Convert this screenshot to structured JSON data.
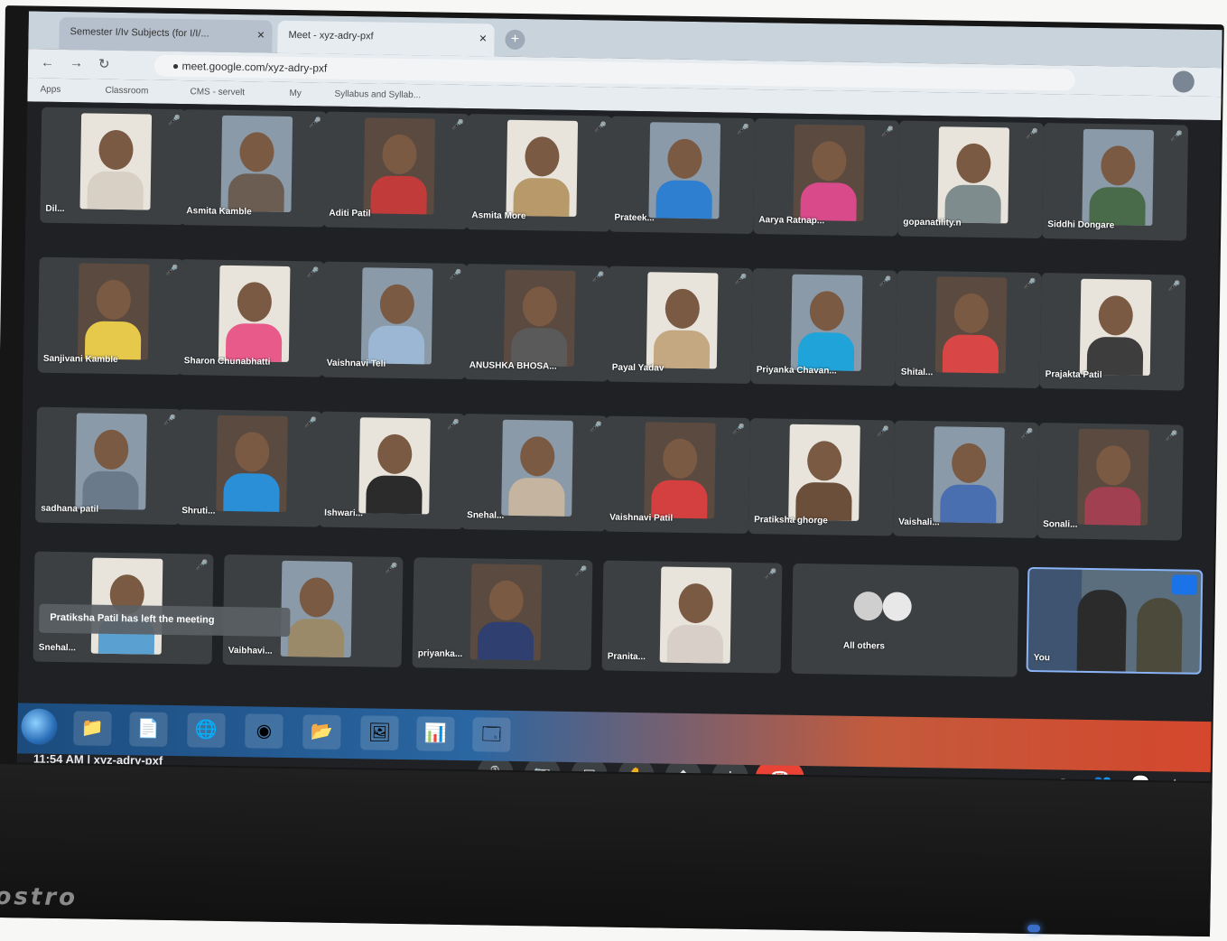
{
  "browser": {
    "tabs": [
      {
        "label": "Semester I/Iv Subjects (for I/I/..."
      },
      {
        "label": "Meet - xyz-adry-pxf"
      }
    ],
    "url": "meet.google.com/xyz-adry-pxf",
    "bookmarks": [
      "Apps",
      "Classroom",
      "CMS - servelt",
      "My",
      "Syllabus and Syllab..."
    ]
  },
  "participants": [
    {
      "name": "Dil..."
    },
    {
      "name": "Asmita Kamble"
    },
    {
      "name": "Aditi Patil"
    },
    {
      "name": "Asmita More"
    },
    {
      "name": "Prateek..."
    },
    {
      "name": "Aarya Ratnap..."
    },
    {
      "name": "gopanatility.n"
    },
    {
      "name": "Siddhi Dongare"
    },
    {
      "name": "Sanjivani Kamble"
    },
    {
      "name": "Sharon Chunabhatti"
    },
    {
      "name": "Vaishnavi Teli"
    },
    {
      "name": "ANUSHKA BHOSA..."
    },
    {
      "name": "Payal Yadav"
    },
    {
      "name": "Priyanka Chavan..."
    },
    {
      "name": "Shital..."
    },
    {
      "name": "Prajakta Patil"
    },
    {
      "name": "sadhana patil"
    },
    {
      "name": "Shruti..."
    },
    {
      "name": "Ishwari..."
    },
    {
      "name": "Snehal..."
    },
    {
      "name": "Vaishnavi Patil"
    },
    {
      "name": "Pratiksha ghorge"
    },
    {
      "name": "Vaishali..."
    },
    {
      "name": "Sonali..."
    },
    {
      "name": "Snehal..."
    },
    {
      "name": "Vaibhavi..."
    },
    {
      "name": "priyanka..."
    },
    {
      "name": "Pranita..."
    }
  ],
  "notification": "Pratiksha Patil has left the meeting",
  "others_label": "All others",
  "self_label": "You",
  "meeting_time": "11:54 AM",
  "meeting_code": "xyz-adry-pxf",
  "brand": "ostro",
  "colors": {
    "end_call": "#ea4335",
    "meet_bg": "#202124",
    "tile_bg": "#3c4043"
  }
}
